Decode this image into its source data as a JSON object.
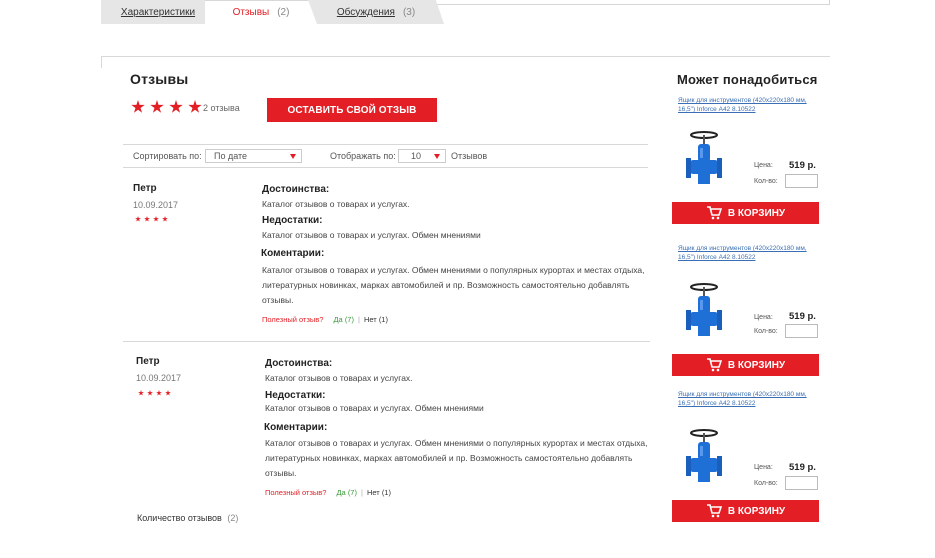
{
  "tabs": [
    {
      "label": "Характеристики",
      "count": ""
    },
    {
      "label": "Отзывы",
      "count": "(2)"
    },
    {
      "label": "Обсуждения",
      "count": "(3)"
    }
  ],
  "reviews_section": {
    "title": "Отзывы",
    "rating_stars": 4,
    "review_count_text": "2 отзыва",
    "leave_review_button": "ОСТАВИТЬ СВОЙ ОТЗЫВ"
  },
  "sortbar": {
    "sort_label": "Сортировать по:",
    "sort_value": "По дате",
    "show_label": "Отображать по:",
    "show_value": "10",
    "per_label": "Отзывов"
  },
  "reviews": [
    {
      "name": "Петр",
      "date": "10.09.2017",
      "stars": 4,
      "pros_h": "Достоинства:",
      "pros": "Каталог отзывов о товарах и услугах.",
      "cons_h": "Недостатки:",
      "cons": "Каталог отзывов о товарах и услугах. Обмен мнениями",
      "comm_h": "Коментарии:",
      "comment": "Каталог отзывов о товарах и услугах. Обмен мнениями о популярных курортах и местах отдыха, литературных новинках, марках автомобилей и пр. Возможность самостоятельно добавлять отзывы.",
      "useful_q": "Полезный отзыв?",
      "yes": "Да",
      "yes_count": "(7)",
      "no": "Нет",
      "no_count": "(1)"
    },
    {
      "name": "Петр",
      "date": "10.09.2017",
      "stars": 4,
      "pros_h": "Достоинства:",
      "pros": "Каталог отзывов о товарах и услугах.",
      "cons_h": "Недостатки:",
      "cons": "Каталог отзывов о товарах и услугах. Обмен мнениями",
      "comm_h": "Коментарии:",
      "comment": "Каталог отзывов о товарах и услугах. Обмен мнениями о популярных курортах и местах отдыха, литературных новинках, марках автомобилей и пр. Возможность самостоятельно добавлять отзывы.",
      "useful_q": "Полезный отзыв?",
      "yes": "Да",
      "yes_count": "(7)",
      "no": "Нет",
      "no_count": "(1)"
    }
  ],
  "total": {
    "label": "Количество отзывов",
    "count": "(2)"
  },
  "sidebar": {
    "title": "Может понадобиться",
    "products": [
      {
        "name": "Ящик для инструментов (420х220х180 мм, 16,5\") Inforce А42 8.10522",
        "price_label": "Цена:",
        "price": "519 р.",
        "qty_label": "Кол-во:",
        "cart": "В КОРЗИНУ"
      },
      {
        "name": "Ящик для инструментов (420х220х180 мм, 16,5\") Inforce А42 8.10522",
        "price_label": "Цена:",
        "price": "519 р.",
        "qty_label": "Кол-во:",
        "cart": "В КОРЗИНУ"
      },
      {
        "name": "Ящик для инструментов (420х220х180 мм, 16,5\") Inforce А42 8.10522",
        "price_label": "Цена:",
        "price": "519 р.",
        "qty_label": "Кол-во:",
        "cart": "В КОРЗИНУ"
      }
    ]
  },
  "colors": {
    "accent": "#e31e24",
    "link": "#3a6fb5",
    "valve": "#1e6fd6"
  }
}
